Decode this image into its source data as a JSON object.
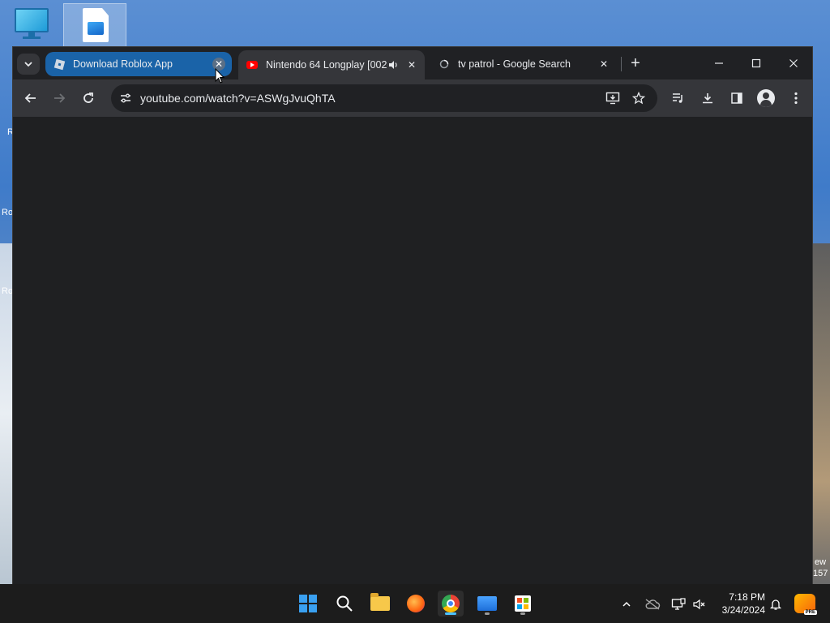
{
  "desktop": {
    "side_labels": [
      "R",
      "Ro",
      "Ro"
    ],
    "right_labels": [
      "ew",
      "157"
    ]
  },
  "browser": {
    "tabs": [
      {
        "title": "Download Roblox App",
        "favicon": "roblox-icon",
        "state": "hover"
      },
      {
        "title": "Nintendo 64 Longplay [002",
        "favicon": "youtube-icon",
        "state": "active",
        "audio": true
      },
      {
        "title": "tv patrol - Google Search",
        "favicon": "google-icon",
        "state": "inactive"
      }
    ],
    "close_glyph": "✕",
    "new_tab_glyph": "+",
    "window_controls": {
      "minimize": "—",
      "maximize": "☐",
      "close": "✕"
    },
    "omnibox": {
      "url": "youtube.com/watch?v=ASWgJvuQhTA"
    }
  },
  "taskbar": {
    "clock_time": "7:18 PM",
    "clock_date": "3/24/2024",
    "copilot_badge": "PRE"
  }
}
